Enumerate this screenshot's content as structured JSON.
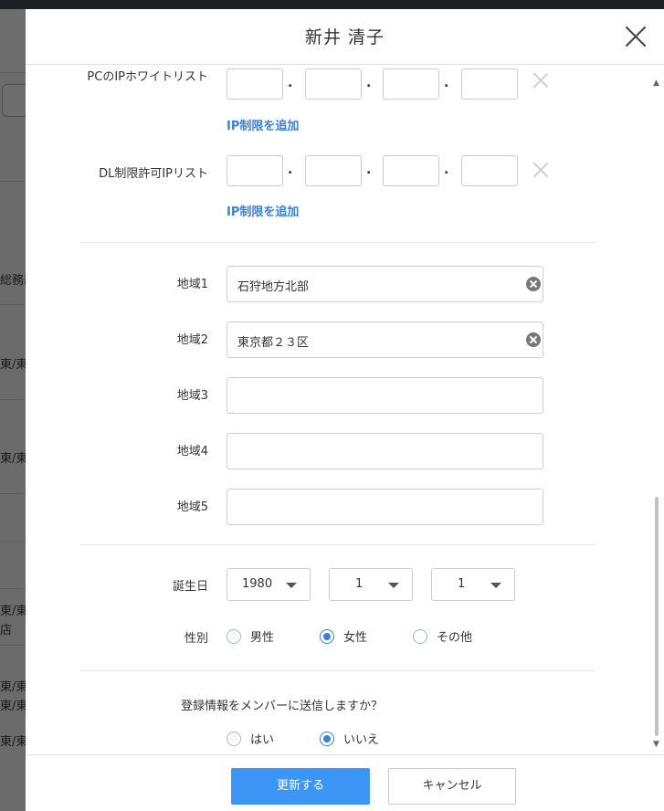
{
  "background": {
    "rows": [
      "総務部",
      "東/東",
      "東/東",
      "東/東",
      "店",
      "東/東",
      "東/東",
      "東/東"
    ]
  },
  "modal": {
    "title": "新井 清子"
  },
  "ip_whitelist": {
    "label": "PCのIPホワイトリスト",
    "add_link": "IP制限を追加",
    "separator": "."
  },
  "dl_allowlist": {
    "label": "DL制限許可IPリスト",
    "add_link": "IP制限を追加",
    "separator": "."
  },
  "regions": [
    {
      "label": "地域1",
      "value": "石狩地方北部"
    },
    {
      "label": "地域2",
      "value": "東京都２３区"
    },
    {
      "label": "地域3",
      "value": ""
    },
    {
      "label": "地域4",
      "value": ""
    },
    {
      "label": "地域5",
      "value": ""
    }
  ],
  "birthday": {
    "label": "誕生日",
    "year": "1980",
    "month": "1",
    "day": "1"
  },
  "gender": {
    "label": "性別",
    "options": [
      "男性",
      "女性",
      "その他"
    ],
    "selected": "女性"
  },
  "notify": {
    "question": "登録情報をメンバーに送信しますか？",
    "options": [
      "はい",
      "いいえ"
    ],
    "selected": "いいえ"
  },
  "footer": {
    "update_label": "更新する",
    "cancel_label": "キャンセル"
  }
}
